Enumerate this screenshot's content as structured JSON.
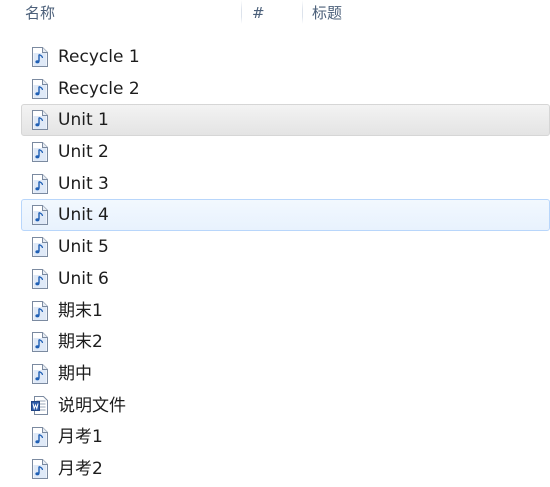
{
  "columns": {
    "name": "名称",
    "number": "#",
    "title": "标题"
  },
  "files": [
    {
      "name": "Recycle 1",
      "icon": "audio-file-icon",
      "state": "normal"
    },
    {
      "name": "Recycle 2",
      "icon": "audio-file-icon",
      "state": "normal"
    },
    {
      "name": "Unit 1",
      "icon": "audio-file-icon",
      "state": "selected"
    },
    {
      "name": "Unit 2",
      "icon": "audio-file-icon",
      "state": "normal"
    },
    {
      "name": "Unit 3",
      "icon": "audio-file-icon",
      "state": "normal"
    },
    {
      "name": "Unit 4",
      "icon": "audio-file-icon",
      "state": "hover"
    },
    {
      "name": "Unit 5",
      "icon": "audio-file-icon",
      "state": "normal"
    },
    {
      "name": "Unit 6",
      "icon": "audio-file-icon",
      "state": "normal"
    },
    {
      "name": "期末1",
      "icon": "audio-file-icon",
      "state": "normal"
    },
    {
      "name": "期末2",
      "icon": "audio-file-icon",
      "state": "normal"
    },
    {
      "name": "期中",
      "icon": "audio-file-icon",
      "state": "normal"
    },
    {
      "name": "说明文件",
      "icon": "document-file-icon",
      "state": "normal"
    },
    {
      "name": "月考1",
      "icon": "audio-file-icon",
      "state": "normal"
    },
    {
      "name": "月考2",
      "icon": "audio-file-icon",
      "state": "normal"
    }
  ],
  "colors": {
    "header_text": "#4c607a",
    "selected_bg": "#e9e9e9",
    "hover_border": "#b8d6fb",
    "icon_blue": "#1f5fb5"
  }
}
